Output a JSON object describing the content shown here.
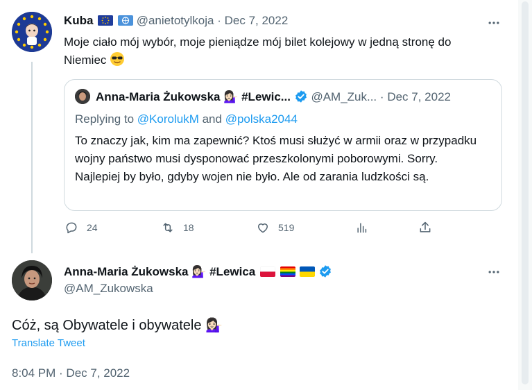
{
  "quoting_tweet": {
    "author_name": "Kuba",
    "handle": "@anietotylkoja",
    "separator": "·",
    "date": "Dec 7, 2022",
    "text": "Moje ciało mój wybór, moje pieniądze mój bilet kolejowy w jedną stronę do Niemiec",
    "emoji": "😎"
  },
  "quoted_tweet": {
    "author_name": "Anna-Maria Żukowska 💁🏻‍♀️ #Lewic...",
    "handle": "@AM_Zuk...",
    "separator": "·",
    "date": "Dec 7, 2022",
    "replying_label": "Replying to",
    "replying_to_1": "@KorolukM",
    "replying_and": "and",
    "replying_to_2": "@polska2044",
    "text": "To znaczy jak, kim ma zapewnić? Ktoś musi służyć w armii oraz w przypadku wojny państwo musi dysponować przeszkolonymi poborowymi. Sorry. Najlepiej by było, gdyby wojen nie było. Ale od zarania ludzkości są."
  },
  "actions": {
    "reply_count": "24",
    "retweet_count": "18",
    "like_count": "519"
  },
  "main_tweet": {
    "author_name": "Anna-Maria Żukowska 💁🏻‍♀️ #Lewica",
    "handle": "@AM_Zukowska",
    "text": "Cóż, są Obywatele i obywatele 💁🏻‍♀️",
    "translate_label": "Translate Tweet",
    "timestamp": "8:04 PM · Dec 7, 2022"
  },
  "colors": {
    "link": "#1d9bf0",
    "muted": "#536471",
    "border": "#cfd9de",
    "verified": "#1d9bf0"
  }
}
